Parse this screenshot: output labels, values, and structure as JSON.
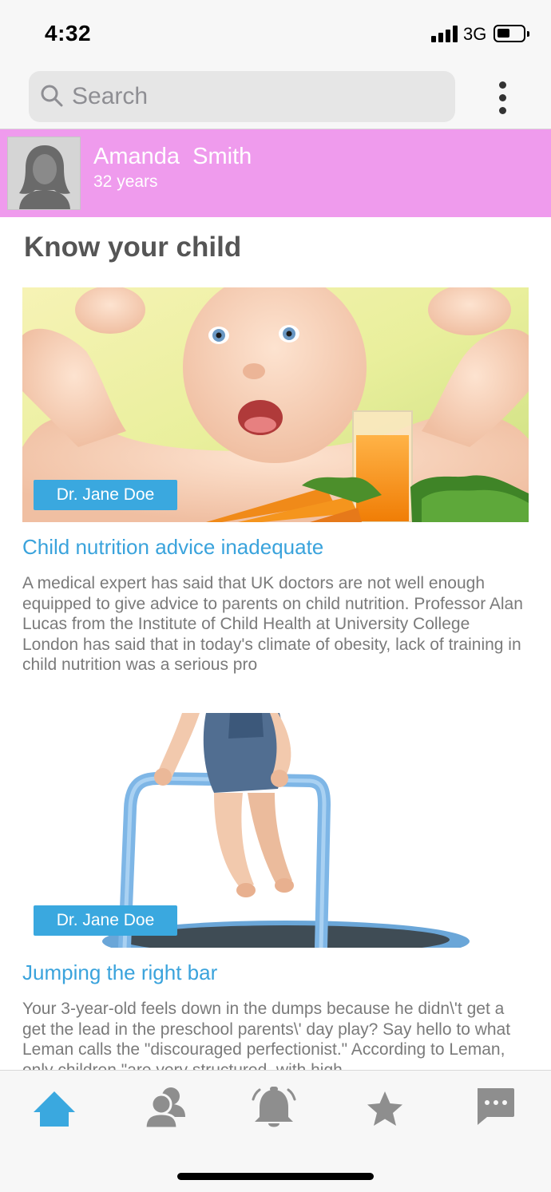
{
  "status_bar": {
    "time": "4:32",
    "network": "3G"
  },
  "search": {
    "placeholder": "Search"
  },
  "profile": {
    "name": "Amanda  Smith",
    "age": "32 years"
  },
  "section": {
    "title": "Know your child"
  },
  "articles": [
    {
      "author": "Dr. Jane Doe",
      "title": "Child nutrition advice inadequate",
      "body": "A medical expert has said that UK doctors are not well enough equipped to give advice to parents on child nutrition. Professor Alan Lucas from the Institute of Child Health at University College London has said that in today's climate of obesity, lack of training in child nutrition was a serious pro"
    },
    {
      "author": "Dr. Jane Doe",
      "title": "Jumping the right bar",
      "body": "Your 3-year-old feels down in the dumps because he didn\\'t get a get the lead in the preschool parents\\' day play? Say hello to what Leman calls the \"discouraged perfectionist.\" According to Leman, only children \"are very structured, with high"
    }
  ],
  "tabbar": {
    "icons": [
      "home-icon",
      "people-icon",
      "bell-icon",
      "star-icon",
      "chat-icon"
    ],
    "active_color": "#3aa8df",
    "inactive_color": "#8e8e8e"
  },
  "colors": {
    "profile_banner": "#ef9bed",
    "accent": "#3aa8df"
  }
}
